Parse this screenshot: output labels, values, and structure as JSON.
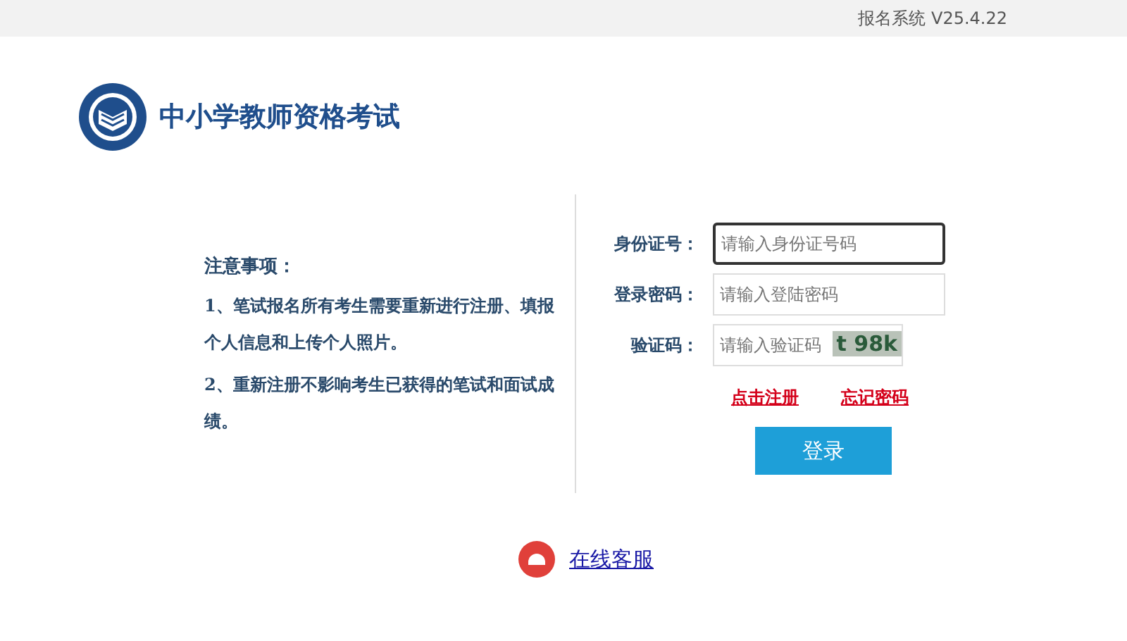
{
  "top_bar": {
    "version": "报名系统 V25.4.22"
  },
  "header": {
    "title": "中小学教师资格考试"
  },
  "notice": {
    "title": "注意事项：",
    "items": [
      "1、笔试报名所有考生需要重新进行注册、填报个人信息和上传个人照片。",
      "2、重新注册不影响考生已获得的笔试和面试成绩。"
    ]
  },
  "form": {
    "fields": [
      {
        "label": "身份证号：",
        "placeholder": "请输入身份证号码",
        "kind": "text",
        "focused": true
      },
      {
        "label": "登录密码：",
        "placeholder": "请输入登陆密码",
        "kind": "password",
        "focused": false
      },
      {
        "label": "验证码：",
        "placeholder": "请输入验证码",
        "kind": "captcha",
        "focused": false,
        "captcha": "t 98k"
      }
    ],
    "links": [
      "点击注册",
      "忘记密码"
    ],
    "submit": "登录"
  },
  "support": {
    "label": "在线客服"
  }
}
